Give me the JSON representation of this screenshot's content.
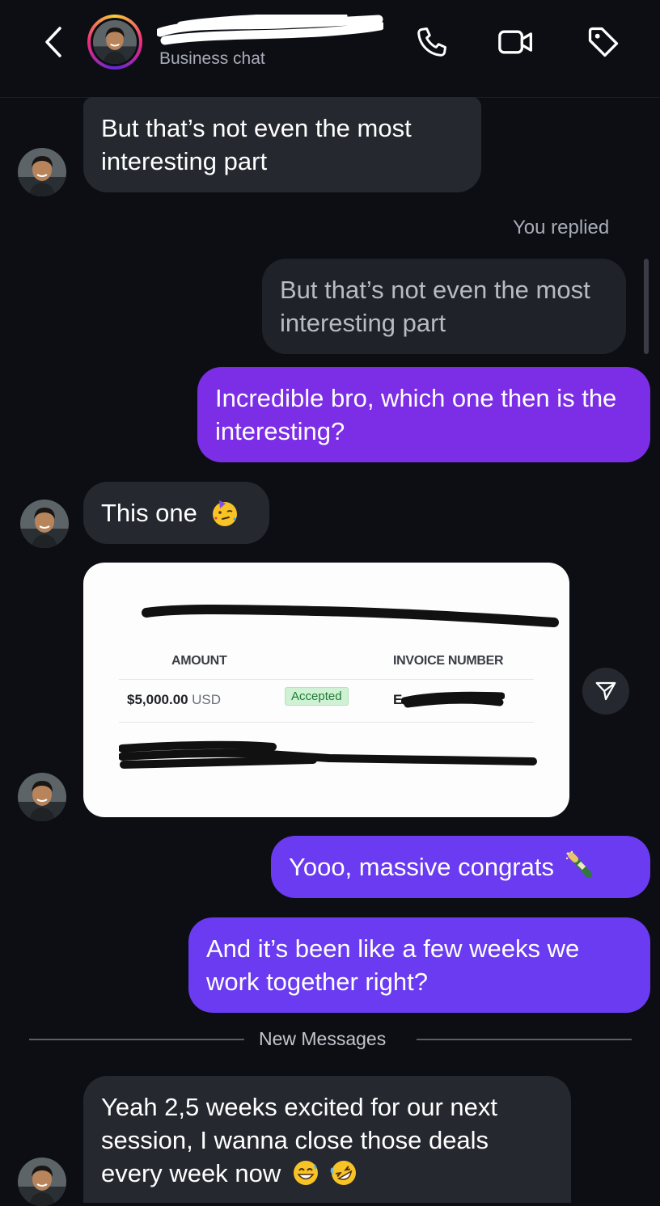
{
  "header": {
    "subtitle": "Business chat",
    "icons": [
      "back-icon",
      "phone-icon",
      "video-icon",
      "tag-icon"
    ]
  },
  "messages": {
    "m1": "But that’s not even the most interesting part",
    "you_replied": "You replied",
    "m2_quote": "But that’s not even the most interesting part",
    "m3": "Incredible bro, which one then is the interesting?",
    "m4": "This one",
    "m6": "Yooo, massive congrats",
    "m7": "And it’s been like a few weeks we work together right?",
    "new_messages": "New Messages",
    "m8": "Yeah 2,5 weeks excited for our next session, I wanna close those deals every week now"
  },
  "invoice": {
    "amount_header": "AMOUNT",
    "invoice_number_header": "INVOICE NUMBER",
    "amount": "$5,000.00",
    "currency": "USD",
    "status": "Accepted",
    "invoice_number_prefix": "E"
  },
  "colors": {
    "background": "#0c0e14",
    "received_bubble": "#262830",
    "sent_bubble": "#7c2ee6",
    "sent_bubble_alt": "#6a3bf0",
    "accepted_badge": "#cff1d4"
  }
}
